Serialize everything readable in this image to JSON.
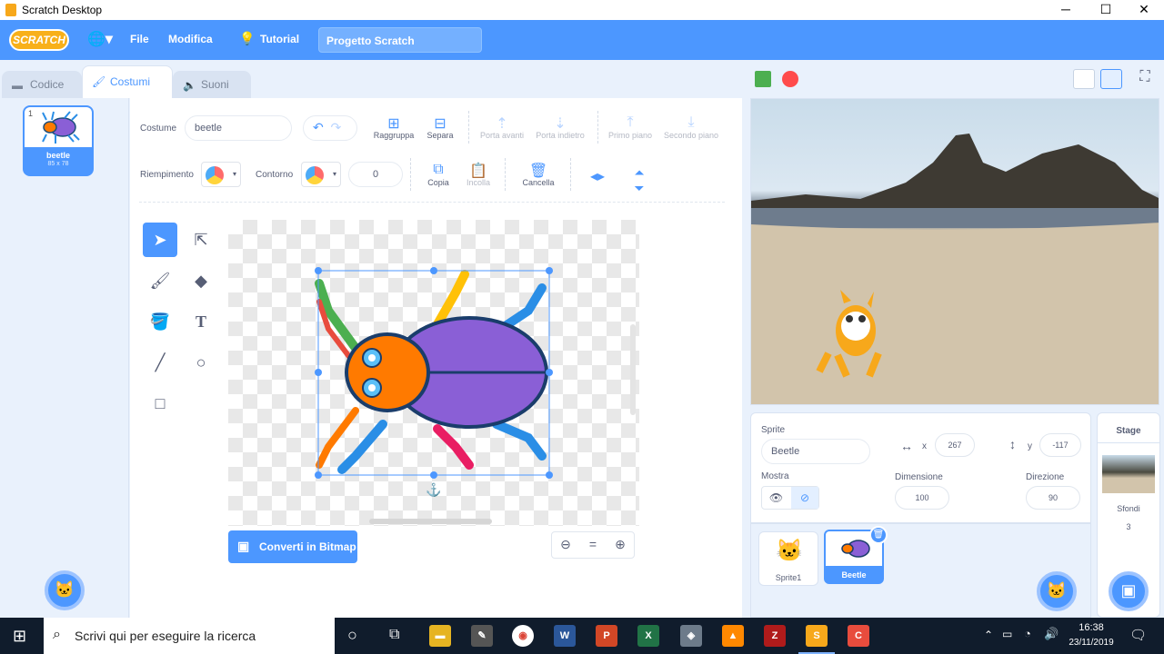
{
  "window": {
    "title": "Scratch Desktop",
    "min": "─",
    "max": "☐",
    "close": "✕"
  },
  "menu": {
    "logo": "SCRATCH",
    "file": "File",
    "edit": "Modifica",
    "tutorial": "Tutorial",
    "project_title": "Progetto Scratch"
  },
  "tabs": [
    {
      "label": "Codice"
    },
    {
      "label": "Costumi"
    },
    {
      "label": "Suoni"
    }
  ],
  "costume_list": {
    "items": [
      {
        "number": "1",
        "name": "beetle",
        "size": "85 x 78"
      }
    ]
  },
  "editor": {
    "costume_label": "Costume",
    "costume_name": "beetle",
    "actions": {
      "group": "Raggruppa",
      "ungroup": "Separa",
      "forward": "Porta avanti",
      "backward": "Porta indietro",
      "front": "Primo piano",
      "back": "Secondo piano",
      "copy": "Copia",
      "paste": "Incolla",
      "delete": "Cancella"
    },
    "fill_label": "Riempimento",
    "outline_label": "Contorno",
    "outline_width": "0",
    "convert_bitmap": "Converti in Bitmap",
    "zoom": {
      "out": "⊖",
      "reset": "=",
      "in": "⊕"
    }
  },
  "sprite_info": {
    "sprite_label": "Sprite",
    "sprite_name": "Beetle",
    "x_label": "x",
    "x": "267",
    "y_label": "y",
    "y": "-117",
    "show_label": "Mostra",
    "size_label": "Dimensione",
    "size": "100",
    "direction_label": "Direzione",
    "direction": "90"
  },
  "sprites": [
    {
      "name": "Sprite1"
    },
    {
      "name": "Beetle"
    }
  ],
  "stage_panel": {
    "title": "Stage",
    "backdrops_label": "Sfondi",
    "backdrops_count": "3"
  },
  "taskbar": {
    "search_placeholder": "Scrivi qui per eseguire la ricerca",
    "time": "16:38",
    "date": "23/11/2019"
  }
}
